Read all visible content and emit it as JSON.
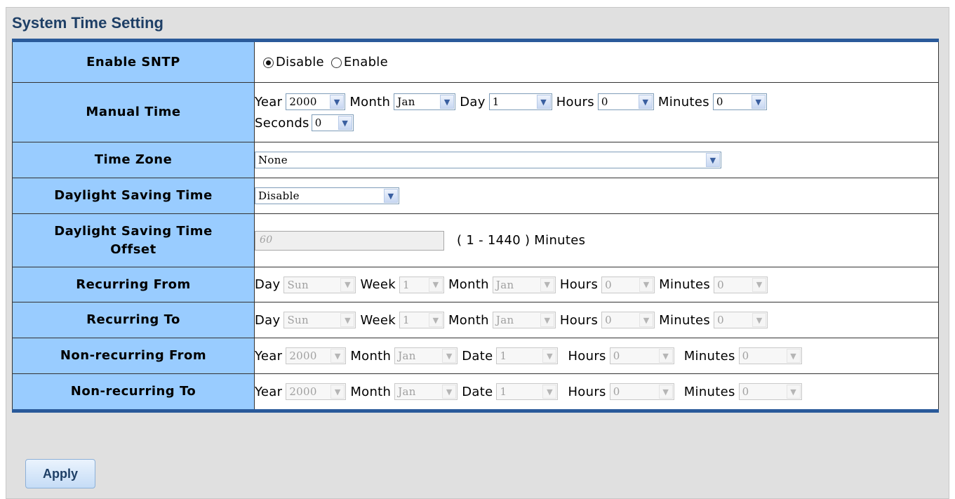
{
  "page": {
    "title": "System Time Setting",
    "apply_label": "Apply"
  },
  "sntp": {
    "label": "Enable SNTP",
    "options": [
      "Disable",
      "Enable"
    ],
    "selected": "Disable"
  },
  "manual": {
    "label": "Manual Time",
    "year_label": "Year",
    "year": "2000",
    "month_label": "Month",
    "month": "Jan",
    "day_label": "Day",
    "day": "1",
    "hours_label": "Hours",
    "hours": "0",
    "minutes_label": "Minutes",
    "minutes": "0",
    "seconds_label": "Seconds",
    "seconds": "0"
  },
  "timezone": {
    "label": "Time Zone",
    "value": "None"
  },
  "dst": {
    "label": "Daylight Saving Time",
    "value": "Disable"
  },
  "dst_offset": {
    "label_line1": "Daylight Saving Time",
    "label_line2": "Offset",
    "value": "60",
    "range_text": "( 1 - 1440 ) Minutes"
  },
  "recurring_from": {
    "label": "Recurring From",
    "day_label": "Day",
    "day": "Sun",
    "week_label": "Week",
    "week": "1",
    "month_label": "Month",
    "month": "Jan",
    "hours_label": "Hours",
    "hours": "0",
    "minutes_label": "Minutes",
    "minutes": "0"
  },
  "recurring_to": {
    "label": "Recurring To",
    "day_label": "Day",
    "day": "Sun",
    "week_label": "Week",
    "week": "1",
    "month_label": "Month",
    "month": "Jan",
    "hours_label": "Hours",
    "hours": "0",
    "minutes_label": "Minutes",
    "minutes": "0"
  },
  "nonrecurring_from": {
    "label": "Non-recurring From",
    "year_label": "Year",
    "year": "2000",
    "month_label": "Month",
    "month": "Jan",
    "date_label": "Date",
    "date": "1",
    "hours_label": "Hours",
    "hours": "0",
    "minutes_label": "Minutes",
    "minutes": "0"
  },
  "nonrecurring_to": {
    "label": "Non-recurring To",
    "year_label": "Year",
    "year": "2000",
    "month_label": "Month",
    "month": "Jan",
    "date_label": "Date",
    "date": "1",
    "hours_label": "Hours",
    "hours": "0",
    "minutes_label": "Minutes",
    "minutes": "0"
  },
  "colors": {
    "label_bg": "#99ccff",
    "accent": "#2a5a9a",
    "panel_bg": "#e0e0e0",
    "title": "#1e3f66"
  },
  "icons": {
    "dropdown": "chevron-down-icon",
    "radio": "radio-icon"
  }
}
